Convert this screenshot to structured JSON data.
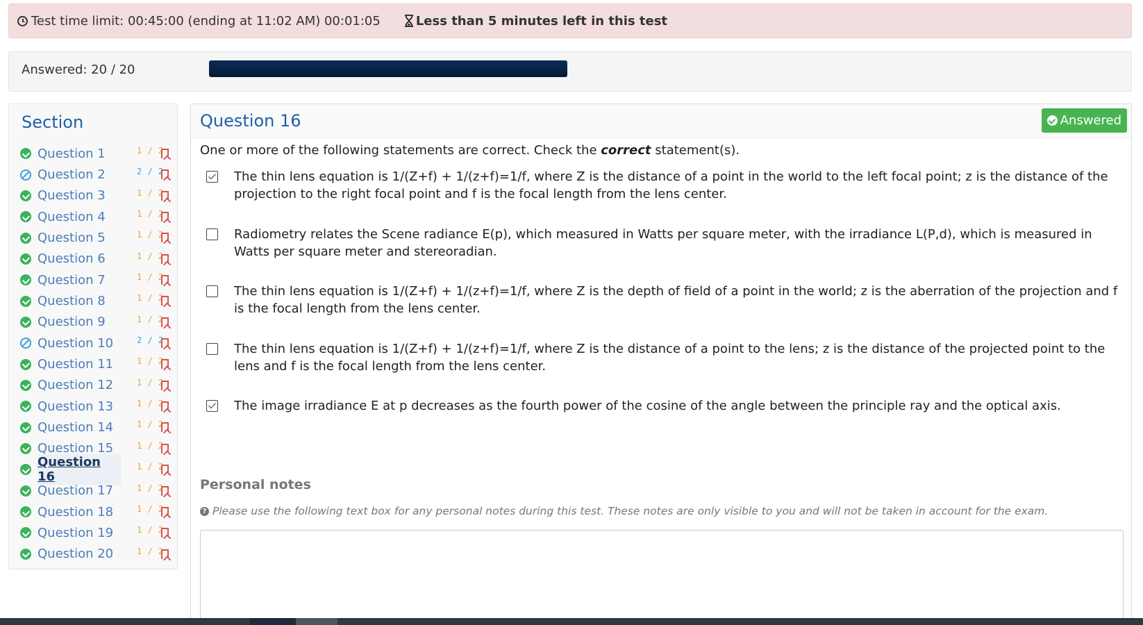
{
  "alert": {
    "time_text": "Test time limit: 00:45:00 (ending at 11:02 AM) 00:01:05",
    "warning": "Less than 5 minutes left in this test"
  },
  "progress": {
    "answered_text": "Answered: 20 / 20",
    "fraction": 1.0
  },
  "sidebar": {
    "title": "Section",
    "items": [
      {
        "label": "Question 1",
        "status": "answered",
        "score": "1 / 2"
      },
      {
        "label": "Question 2",
        "status": "skipped",
        "score": "2 / 2"
      },
      {
        "label": "Question 3",
        "status": "answered",
        "score": "1 / 2"
      },
      {
        "label": "Question 4",
        "status": "answered",
        "score": "1 / 2"
      },
      {
        "label": "Question 5",
        "status": "answered",
        "score": "1 / 2"
      },
      {
        "label": "Question 6",
        "status": "answered",
        "score": "1 / 2"
      },
      {
        "label": "Question 7",
        "status": "answered",
        "score": "1 / 2"
      },
      {
        "label": "Question 8",
        "status": "answered",
        "score": "1 / 2"
      },
      {
        "label": "Question 9",
        "status": "answered",
        "score": "1 / 2"
      },
      {
        "label": "Question 10",
        "status": "skipped",
        "score": "2 / 2"
      },
      {
        "label": "Question 11",
        "status": "answered",
        "score": "1 / 2"
      },
      {
        "label": "Question 12",
        "status": "answered",
        "score": "1 / 2"
      },
      {
        "label": "Question 13",
        "status": "answered",
        "score": "1 / 2"
      },
      {
        "label": "Question 14",
        "status": "answered",
        "score": "1 / 2"
      },
      {
        "label": "Question 15",
        "status": "answered",
        "score": "1 / 2"
      },
      {
        "label": "Question 16",
        "status": "answered",
        "score": "1 / 2",
        "current": true
      },
      {
        "label": "Question 17",
        "status": "answered",
        "score": "1 / 2"
      },
      {
        "label": "Question 18",
        "status": "answered",
        "score": "1 / 2"
      },
      {
        "label": "Question 19",
        "status": "answered",
        "score": "1 / 2"
      },
      {
        "label": "Question 20",
        "status": "answered",
        "score": "1 / 2"
      }
    ]
  },
  "question": {
    "title": "Question 16",
    "badge": "Answered",
    "prompt_before": "One or more of the following statements are correct. Check the ",
    "prompt_emphasis": "correct",
    "prompt_after": " statement(s).",
    "options": [
      {
        "checked": true,
        "text": "The thin lens equation is 1/(Z+f) + 1/(z+f)=1/f, where Z is the distance of a point in the world to the left focal point; z is the distance of the projection to the right focal point and f is the focal length from the lens center."
      },
      {
        "checked": false,
        "text": "Radiometry relates the Scene radiance E(p), which measured in Watts per square meter, with the irradiance L(P,d), which is measured in Watts per square meter and stereoradian."
      },
      {
        "checked": false,
        "text": "The thin lens equation is 1/(Z+f) + 1/(z+f)=1/f, where Z is the depth of field of a point in the world; z is the aberration of the projection and f is the focal length from the lens center."
      },
      {
        "checked": false,
        "text": "The thin lens equation is 1/(Z+f) + 1/(z+f)=1/f, where Z is the distance of a point to the lens; z is the distance of the projected point to the lens and f is the focal length from the lens center."
      },
      {
        "checked": true,
        "text": "The image irradiance E at p decreases as the fourth power of the cosine of the angle between the principle ray and the optical axis."
      }
    ]
  },
  "notes": {
    "title": "Personal notes",
    "hint": "Please use the following text box for any personal notes during this test. These notes are only visible to you and will not be taken in account for the exam.",
    "value": ""
  },
  "colors": {
    "answered_green": "#3cb25a",
    "skipped_blue": "#3c9fd8",
    "score_orange": "#f0a030",
    "bookmark_red": "#d9534f",
    "heading_blue": "#1f5fa8",
    "progress_navy": "#031a36",
    "alert_bg": "#f2dede"
  }
}
